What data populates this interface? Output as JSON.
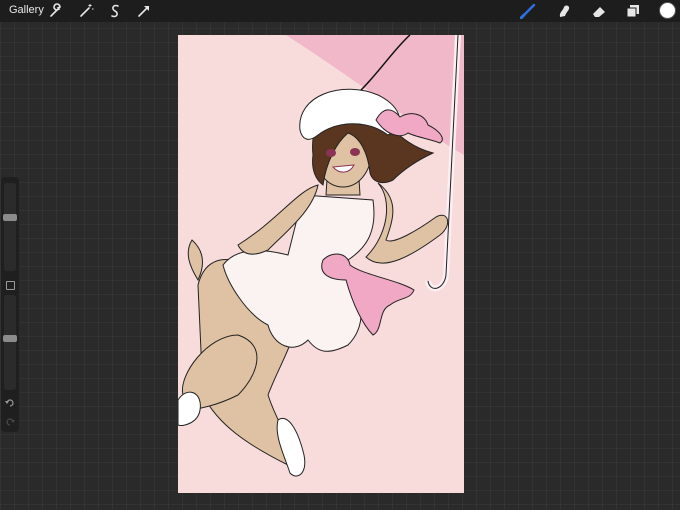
{
  "topbar": {
    "gallery_label": "Gallery",
    "tools_left": [
      "wrench-icon",
      "magic-wand-icon",
      "selection-icon",
      "transform-arrow-icon"
    ],
    "tools_right": [
      "brush-icon",
      "smudge-icon",
      "eraser-icon",
      "layers-icon"
    ],
    "active_tool": "brush",
    "current_color": "#ffffff"
  },
  "sidebar": {
    "brush_size_level": 0.62,
    "opacity_level": 0.55
  },
  "colors": {
    "canvas_background": "#f8dcdc",
    "umbrella": "#f0b8c9",
    "skin": "#dfc2a3",
    "hair": "#5a3621",
    "dress": "#fbf2f2",
    "ribbon": "#f0a8c4",
    "accent_brush": "#2f6fe4"
  }
}
